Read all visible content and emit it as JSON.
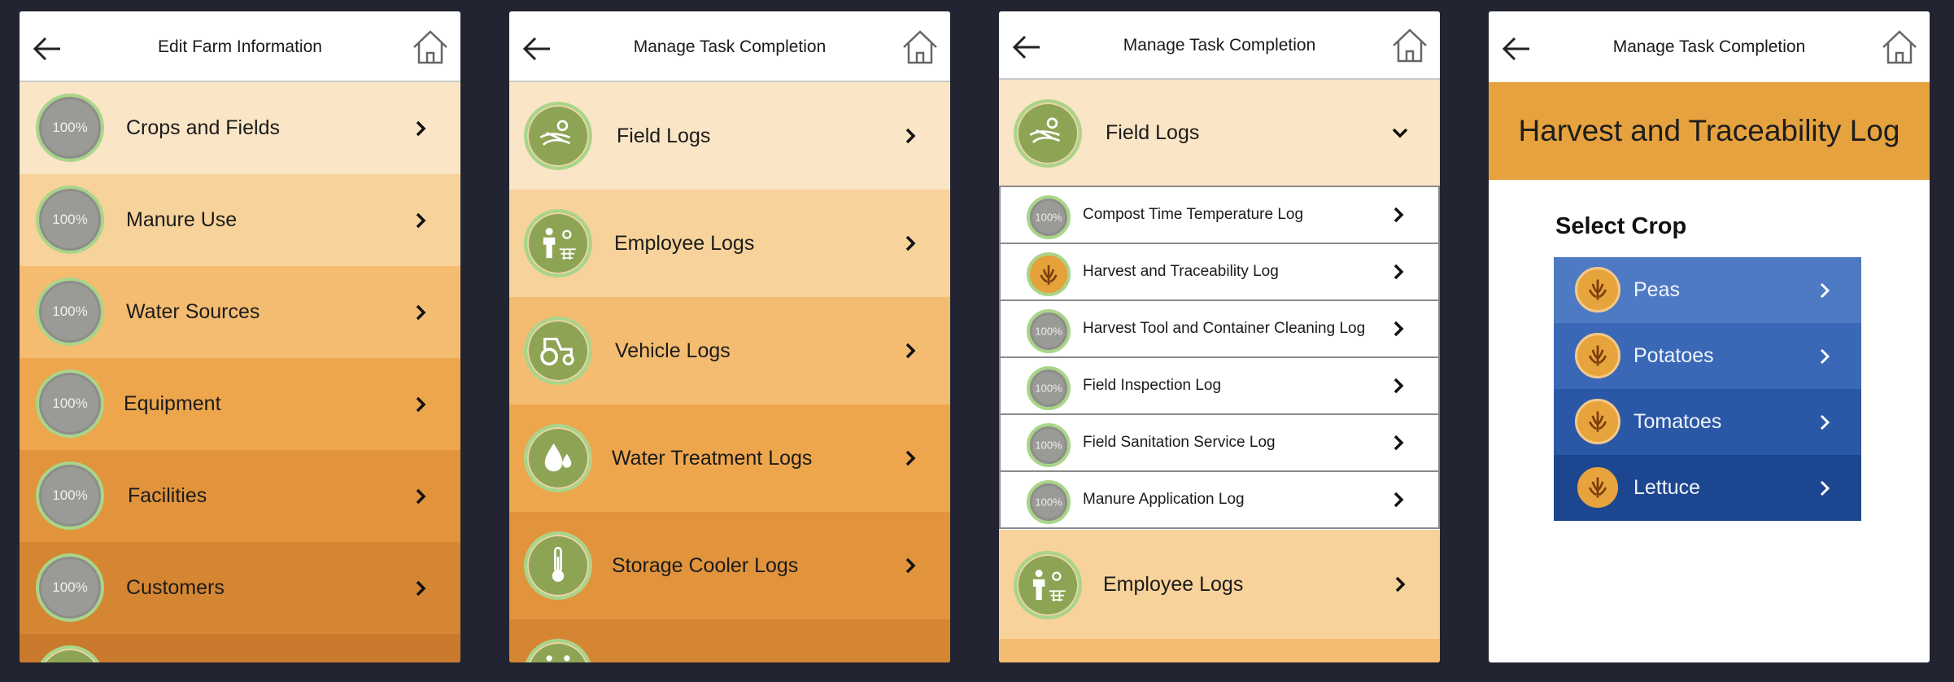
{
  "screens": [
    {
      "title": "Edit Farm Information",
      "rows": [
        {
          "label": "Crops and Fields",
          "badge": "100%",
          "bg": "#fae5c6"
        },
        {
          "label": "Manure Use",
          "badge": "100%",
          "bg": "#f7d29a"
        },
        {
          "label": "Water Sources",
          "badge": "100%",
          "bg": "#f4bc71"
        },
        {
          "label": "Equipment",
          "badge": "100%",
          "bg": "#eea64d"
        },
        {
          "label": "Facilities",
          "badge": "100%",
          "bg": "#e2943c"
        },
        {
          "label": "Customers",
          "badge": "100%",
          "bg": "#d58633"
        },
        {
          "label": "",
          "badge": "",
          "bg": "#c9792c"
        }
      ]
    },
    {
      "title": "Manage Task Completion",
      "rows": [
        {
          "label": "Field Logs",
          "icon": "field-icon",
          "bg": "#fae5c6"
        },
        {
          "label": "Employee Logs",
          "icon": "employee-icon",
          "bg": "#f7d29a"
        },
        {
          "label": "Vehicle Logs",
          "icon": "tractor-icon",
          "bg": "#f4bc71"
        },
        {
          "label": "Water Treatment Logs",
          "icon": "water-drop-icon",
          "bg": "#eea64d"
        },
        {
          "label": "Storage Cooler Logs",
          "icon": "thermometer-icon",
          "bg": "#e2943c"
        },
        {
          "label": "",
          "icon": "vehicle-icon",
          "bg": "#d58633"
        }
      ]
    },
    {
      "title": "Manage Task Completion",
      "header_row": {
        "label": "Field Logs",
        "icon": "field-icon",
        "bg": "#fae5c6"
      },
      "sub_rows": [
        {
          "label": "Compost Time Temperature Log",
          "badge": "100%",
          "type": "gray"
        },
        {
          "label": "Harvest and Traceability Log",
          "badge": "",
          "type": "wheat"
        },
        {
          "label": "Harvest Tool and Container Cleaning Log",
          "badge": "100%",
          "type": "gray"
        },
        {
          "label": "Field Inspection Log",
          "badge": "100%",
          "type": "gray"
        },
        {
          "label": "Field Sanitation Service Log",
          "badge": "100%",
          "type": "gray"
        },
        {
          "label": "Manure Application Log",
          "badge": "100%",
          "type": "gray"
        }
      ],
      "footer_row": {
        "label": "Employee Logs",
        "icon": "employee-icon",
        "bg": "#f7d29a"
      }
    },
    {
      "title": "Manage Task Completion",
      "banner": "Harvest and Traceability Log",
      "select_label": "Select Crop",
      "crops": [
        {
          "label": "Peas",
          "bg": "#4e7ac4"
        },
        {
          "label": "Potatoes",
          "bg": "#3a68b7"
        },
        {
          "label": "Tomatoes",
          "bg": "#2a58a6"
        },
        {
          "label": "Lettuce",
          "bg": "#1d4690"
        }
      ]
    }
  ],
  "colors": {
    "banner": "#e6a23e",
    "badge_green": "#8ea455",
    "badge_ring": "#a9d58a"
  }
}
